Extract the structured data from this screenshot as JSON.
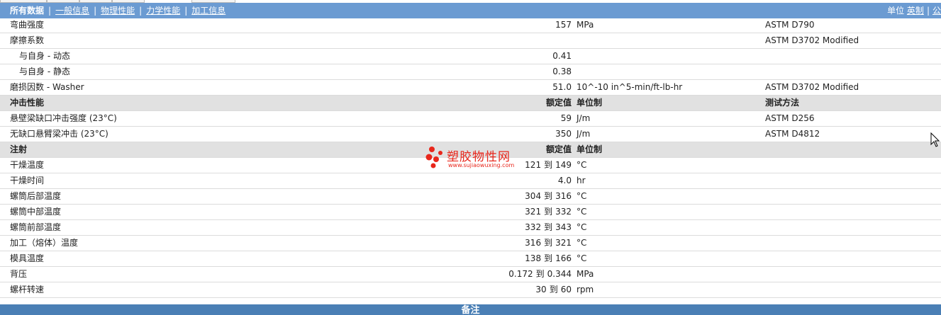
{
  "nav": {
    "tabs": [
      {
        "label": "所有数据"
      },
      {
        "label": "一般信息"
      },
      {
        "label": "物理性能"
      },
      {
        "label": "力学性能"
      },
      {
        "label": "加工信息"
      }
    ],
    "units_label": "单位",
    "units_imperial": "英制",
    "units_metric_partial": "公"
  },
  "rows": [
    {
      "name": "弯曲强度",
      "value": "157",
      "unit": "MPa",
      "test": "ASTM D790"
    },
    {
      "name": "摩擦系数",
      "value": "",
      "unit": "",
      "test": "ASTM D3702 Modified"
    },
    {
      "name": "与自身 - 动态",
      "value": "0.41",
      "unit": "",
      "test": ""
    },
    {
      "name": "与自身 - 静态",
      "value": "0.38",
      "unit": "",
      "test": ""
    },
    {
      "name": "磨损因数 - Washer",
      "value": "51.0",
      "unit": "10^-10 in^5-min/ft-lb-hr",
      "test": "ASTM D3702 Modified"
    },
    {
      "name": "冲击性能",
      "value": "额定值",
      "unit": "单位制",
      "test": "测试方法"
    },
    {
      "name": "悬壁梁缺口冲击强度 (23°C)",
      "value": "59",
      "unit": "J/m",
      "test": "ASTM D256"
    },
    {
      "name": "无缺口悬臂梁冲击 (23°C)",
      "value": "350",
      "unit": "J/m",
      "test": "ASTM D4812"
    },
    {
      "name": "注射",
      "value": "额定值",
      "unit": "单位制",
      "test": ""
    },
    {
      "name": "干燥温度",
      "value_from": "121",
      "value_to": "149",
      "to_word": "到",
      "unit": "°C",
      "test": ""
    },
    {
      "name": "干燥时间",
      "value": "4.0",
      "unit": "hr",
      "test": ""
    },
    {
      "name": "螺筒后部温度",
      "value_from": "304",
      "value_to": "316",
      "to_word": "到",
      "unit": "°C",
      "test": ""
    },
    {
      "name": "螺筒中部温度",
      "value_from": "321",
      "value_to": "332",
      "to_word": "到",
      "unit": "°C",
      "test": ""
    },
    {
      "name": "螺筒前部温度",
      "value_from": "332",
      "value_to": "343",
      "to_word": "到",
      "unit": "°C",
      "test": ""
    },
    {
      "name": "加工（熔体）温度",
      "value_from": "316",
      "value_to": "321",
      "to_word": "到",
      "unit": "°C",
      "test": ""
    },
    {
      "name": "模具温度",
      "value_from": "138",
      "value_to": "166",
      "to_word": "到",
      "unit": "°C",
      "test": ""
    },
    {
      "name": "背压",
      "value_from": "0.172",
      "value_to": "0.344",
      "to_word": "到",
      "unit": "MPa",
      "test": ""
    },
    {
      "name": "螺杆转速",
      "value_from": "30",
      "value_to": "60",
      "to_word": "到",
      "unit": "rpm",
      "test": ""
    }
  ],
  "footer": {
    "label": "备注"
  },
  "watermark": {
    "title": "塑胶物性网",
    "url": "www.sujiaowuxing.com"
  },
  "colors": {
    "nav_bg": "#6b9bd2",
    "footer_bg": "#4a7fb5",
    "header_row_bg": "#e1e1e1",
    "watermark": "#e8271c"
  }
}
